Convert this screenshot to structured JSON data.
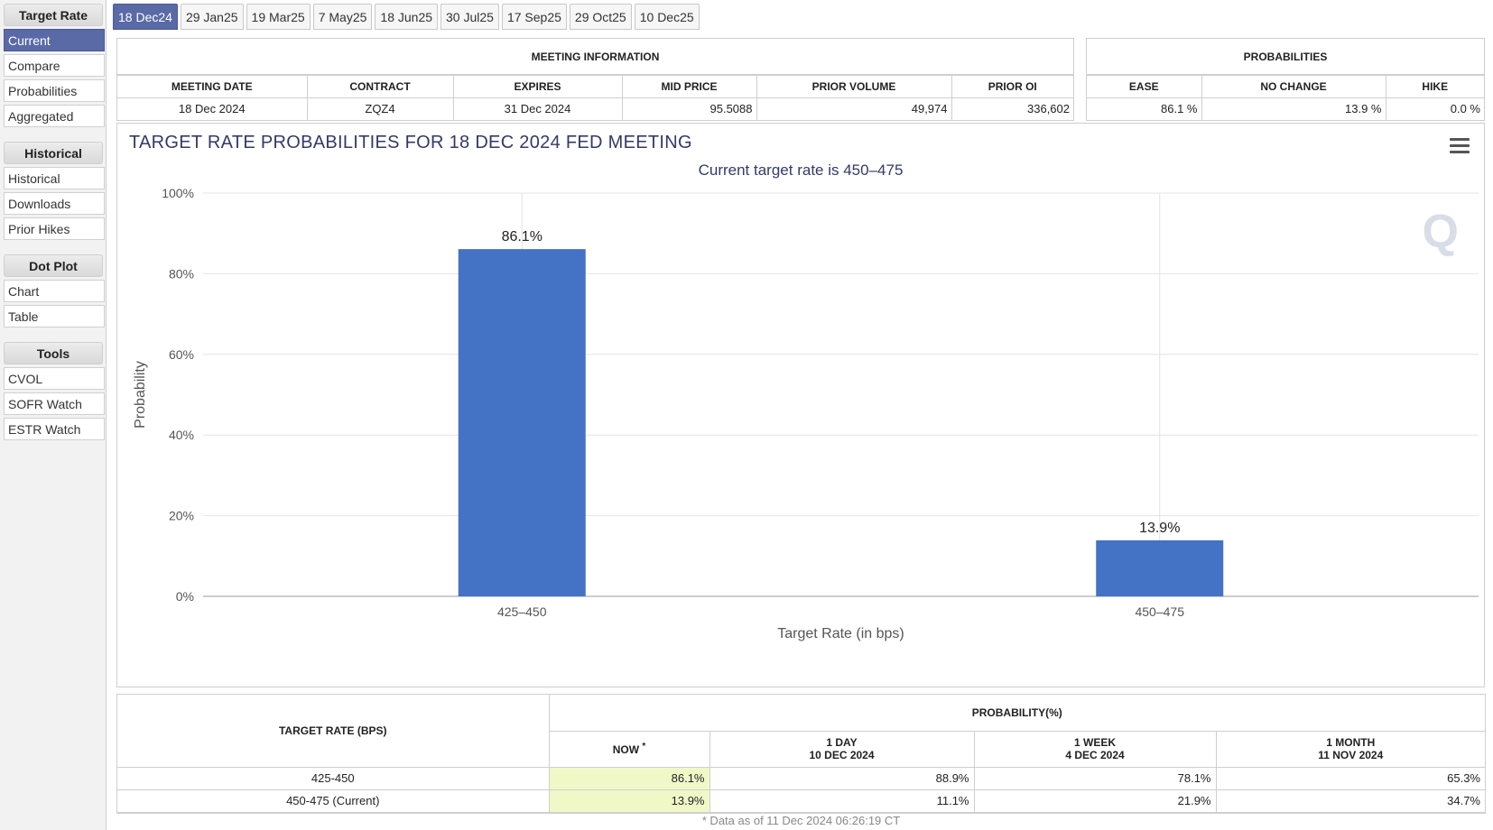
{
  "sidebar": {
    "groups": [
      {
        "heading": "Target Rate",
        "items": [
          "Current",
          "Compare",
          "Probabilities",
          "Aggregated"
        ]
      },
      {
        "heading": "Historical",
        "items": [
          "Historical",
          "Downloads",
          "Prior Hikes"
        ]
      },
      {
        "heading": "Dot Plot",
        "items": [
          "Chart",
          "Table"
        ]
      },
      {
        "heading": "Tools",
        "items": [
          "CVOL",
          "SOFR Watch",
          "ESTR Watch"
        ]
      }
    ],
    "active": "Current"
  },
  "tabs": [
    "18 Dec24",
    "29 Jan25",
    "19 Mar25",
    "7 May25",
    "18 Jun25",
    "30 Jul25",
    "17 Sep25",
    "29 Oct25",
    "10 Dec25"
  ],
  "meeting_info": {
    "title": "MEETING INFORMATION",
    "headers": [
      "MEETING DATE",
      "CONTRACT",
      "EXPIRES",
      "MID PRICE",
      "PRIOR VOLUME",
      "PRIOR OI"
    ],
    "values": [
      "18 Dec 2024",
      "ZQZ4",
      "31 Dec 2024",
      "95.5088",
      "49,974",
      "336,602"
    ]
  },
  "probabilities": {
    "title": "PROBABILITIES",
    "headers": [
      "EASE",
      "NO CHANGE",
      "HIKE"
    ],
    "values": [
      "86.1 %",
      "13.9 %",
      "0.0 %"
    ]
  },
  "chart_data": {
    "type": "bar",
    "title": "TARGET RATE PROBABILITIES FOR 18 DEC 2024 FED MEETING",
    "subtitle": "Current target rate is 450–475",
    "categories": [
      "425–450",
      "450–475"
    ],
    "values": [
      86.1,
      13.9
    ],
    "data_labels": [
      "86.1%",
      "13.9%"
    ],
    "xlabel": "Target Rate (in bps)",
    "ylabel": "Probability",
    "ylim": [
      0,
      100
    ],
    "yticks": [
      "0%",
      "20%",
      "40%",
      "60%",
      "80%",
      "100%"
    ],
    "grid": true,
    "bar_color": "#4472c4"
  },
  "bottom_table": {
    "col_header": "TARGET RATE (BPS)",
    "group_header": "PROBABILITY(%)",
    "sub_headers": [
      {
        "line1": "NOW",
        "line2": "",
        "mark": "*"
      },
      {
        "line1": "1 DAY",
        "line2": "10 DEC 2024",
        "mark": ""
      },
      {
        "line1": "1 WEEK",
        "line2": "4 DEC 2024",
        "mark": ""
      },
      {
        "line1": "1 MONTH",
        "line2": "11 NOV 2024",
        "mark": ""
      }
    ],
    "rows": [
      {
        "rate": "425-450",
        "vals": [
          "86.1%",
          "88.9%",
          "78.1%",
          "65.3%"
        ]
      },
      {
        "rate": "450-475 (Current)",
        "vals": [
          "13.9%",
          "11.1%",
          "21.9%",
          "34.7%"
        ]
      }
    ],
    "footnote": "* Data as of 11 Dec 2024 06:26:19 CT"
  }
}
